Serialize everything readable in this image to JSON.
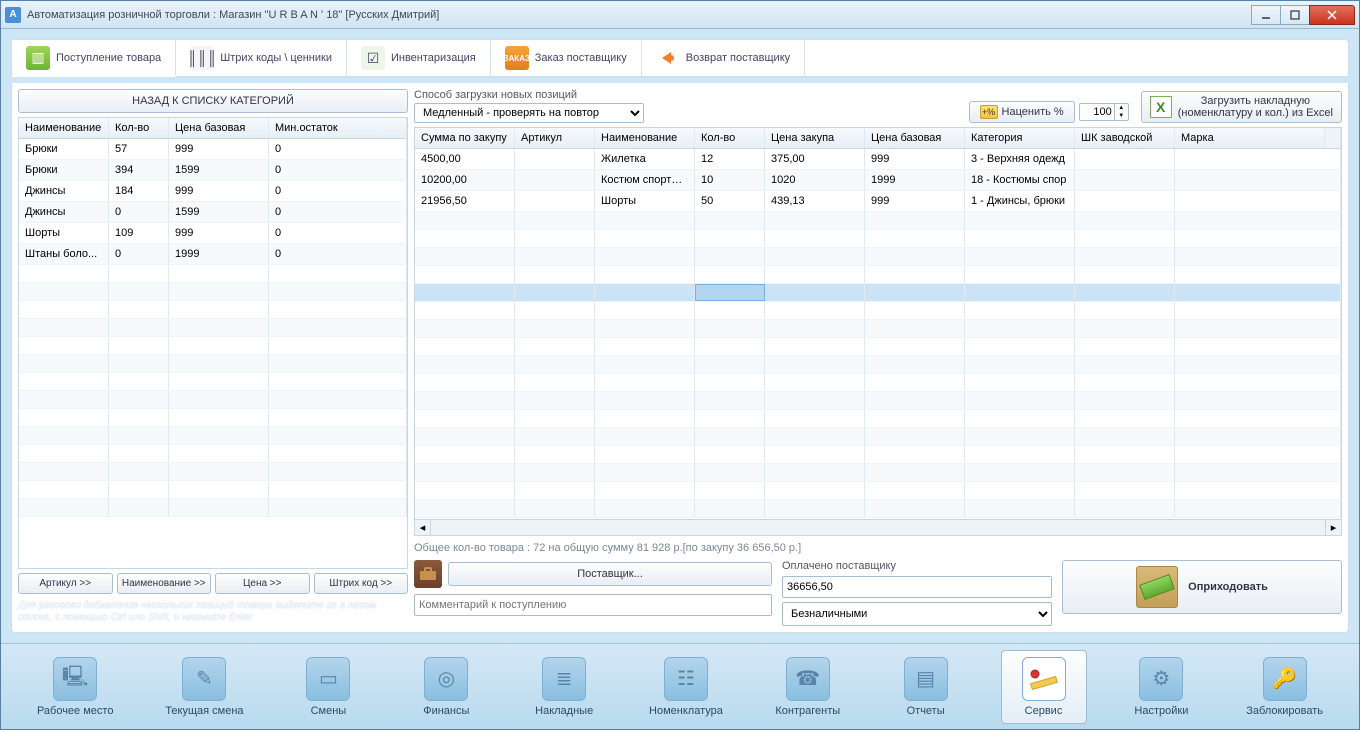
{
  "window": {
    "title": "Автоматизация розничной торговли : Магазин \"U R B A N ' 18\" [Русских Дмитрий]"
  },
  "tabs": [
    {
      "label": "Поступление товара"
    },
    {
      "label": "Штрих коды \\ ценники"
    },
    {
      "label": "Инвентаризация"
    },
    {
      "label": "Заказ поставщику"
    },
    {
      "label": "Возврат поставщику"
    }
  ],
  "left": {
    "back": "НАЗАД К СПИСКУ КАТЕГОРИЙ",
    "headers": {
      "name": "Наименование",
      "qty": "Кол-во",
      "price": "Цена базовая",
      "min": "Мин.остаток"
    },
    "rows": [
      {
        "name": "Брюки",
        "qty": "57",
        "price": "999",
        "min": "0"
      },
      {
        "name": "Брюки",
        "qty": "394",
        "price": "1599",
        "min": "0"
      },
      {
        "name": "Джинсы",
        "qty": "184",
        "price": "999",
        "min": "0"
      },
      {
        "name": "Джинсы",
        "qty": "0",
        "price": "1599",
        "min": "0"
      },
      {
        "name": "Шорты",
        "qty": "109",
        "price": "999",
        "min": "0"
      },
      {
        "name": "Штаны боло...",
        "qty": "0",
        "price": "1999",
        "min": "0"
      }
    ],
    "buttons": {
      "art": "Артикул >>",
      "name": "Наименование >>",
      "price": "Цена >>",
      "barcode": "Штрих код >>"
    },
    "hint": "Для разового добавления нескольких позиций товара выделите их в левом списке, с помощью Ctrl или Shift, и нажмите Enter"
  },
  "right": {
    "loadmode_label": "Способ загрузки новых позиций",
    "loadmode_value": "Медленный - проверять на повтор",
    "markup_btn": "Наценить %",
    "markup_val": "100",
    "excel_line1": "Загрузить накладную",
    "excel_line2": "(номенклатуру и кол.) из Excel",
    "headers": {
      "sum": "Сумма по закупу",
      "art": "Артикул",
      "name": "Наименование",
      "qty": "Кол-во",
      "pprice": "Цена закупа",
      "bprice": "Цена базовая",
      "cat": "Категория",
      "bc": "ШК заводской",
      "brand": "Марка"
    },
    "rows": [
      {
        "sum": "4500,00",
        "art": "",
        "name": "Жилетка",
        "qty": "12",
        "pprice": "375,00",
        "bprice": "999",
        "cat": "3 - Верхняя одежд",
        "bc": "",
        "brand": ""
      },
      {
        "sum": "10200,00",
        "art": "",
        "name": "Костюм спортивн",
        "qty": "10",
        "pprice": "1020",
        "bprice": "1999",
        "cat": "18 - Костюмы спор",
        "bc": "",
        "brand": ""
      },
      {
        "sum": "21956,50",
        "art": "",
        "name": "Шорты",
        "qty": "50",
        "pprice": "439,13",
        "bprice": "999",
        "cat": "1 - Джинсы, брюки",
        "bc": "",
        "brand": ""
      }
    ],
    "summary": "Общее кол-во товара : 72 на общую сумму 81 928 р.[по закупу 36 656,50 р.]",
    "supplier_btn": "Поставщик...",
    "comment_ph": "Комментарий к поступлению",
    "paid_label": "Оплачено поставщику",
    "paid_value": "36656,50",
    "pay_method": "Безналичными",
    "receive": "Оприходовать"
  },
  "nav": [
    {
      "label": "Рабочее место"
    },
    {
      "label": "Текущая смена"
    },
    {
      "label": "Смены"
    },
    {
      "label": "Финансы"
    },
    {
      "label": "Накладные"
    },
    {
      "label": "Номенклатура"
    },
    {
      "label": "Контрагенты"
    },
    {
      "label": "Отчеты"
    },
    {
      "label": "Сервис"
    },
    {
      "label": "Настройки"
    },
    {
      "label": "Заблокировать"
    }
  ]
}
